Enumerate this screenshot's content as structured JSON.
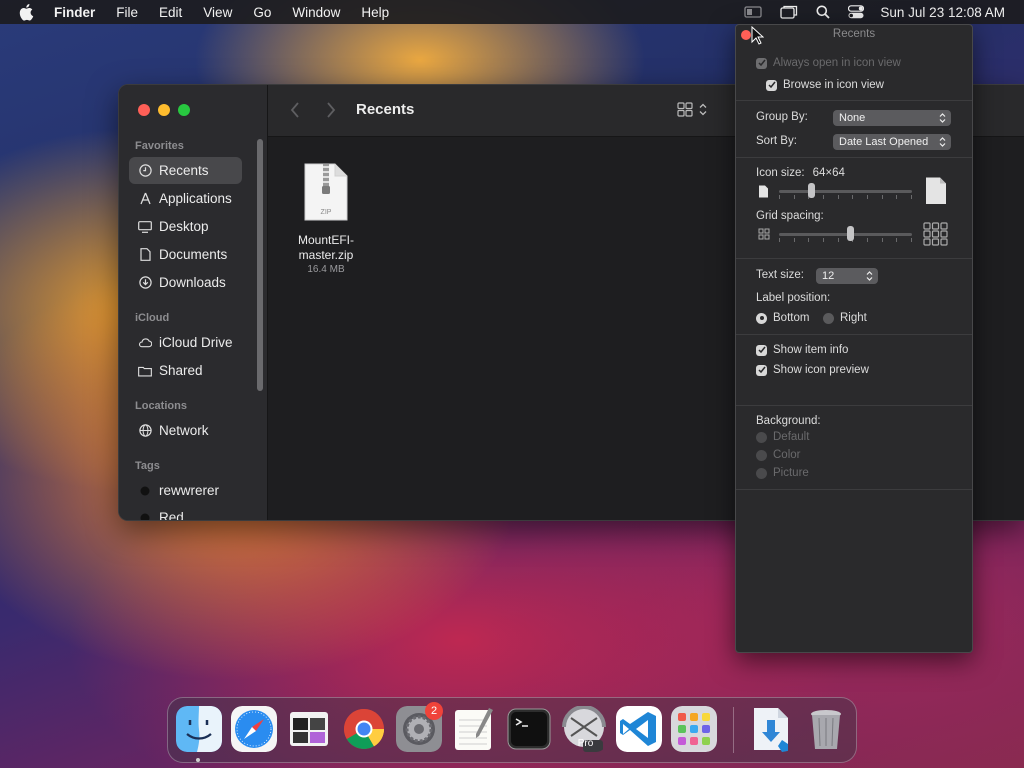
{
  "menubar": {
    "app_name": "Finder",
    "items": [
      "File",
      "Edit",
      "View",
      "Go",
      "Window",
      "Help"
    ],
    "clock": "Sun Jul 23  12:08 AM",
    "status_icons": [
      "screen-mirroring-icon",
      "window-icon",
      "spotlight-icon",
      "control-center-icon"
    ]
  },
  "finder": {
    "title": "Recents",
    "sidebar": {
      "sections": [
        {
          "header": "Favorites",
          "items": [
            {
              "label": "Recents",
              "icon": "clock-icon",
              "active": true
            },
            {
              "label": "Applications",
              "icon": "applications-icon"
            },
            {
              "label": "Desktop",
              "icon": "desktop-icon"
            },
            {
              "label": "Documents",
              "icon": "document-icon"
            },
            {
              "label": "Downloads",
              "icon": "download-icon"
            }
          ]
        },
        {
          "header": "iCloud",
          "items": [
            {
              "label": "iCloud Drive",
              "icon": "cloud-icon"
            },
            {
              "label": "Shared",
              "icon": "shared-folder-icon"
            }
          ]
        },
        {
          "header": "Locations",
          "items": [
            {
              "label": "Network",
              "icon": "globe-icon"
            }
          ]
        },
        {
          "header": "Tags",
          "items": [
            {
              "label": "rewwrerer",
              "icon": "tag-dot-icon"
            },
            {
              "label": "Red",
              "icon": "tag-dot-icon"
            }
          ]
        }
      ]
    },
    "files": [
      {
        "name_line1": "MountEFI-",
        "name_line2": "master.zip",
        "size": "16.4 MB",
        "type_label": "ZIP"
      }
    ]
  },
  "view_options": {
    "title": "Recents",
    "always_open": "Always open in icon view",
    "browse_icon": "Browse in icon view",
    "group_by_label": "Group By:",
    "group_by_value": "None",
    "sort_by_label": "Sort By:",
    "sort_by_value": "Date Last Opened",
    "icon_size_label": "Icon size:",
    "icon_size_value": "64×64",
    "icon_size_fraction": 0.23,
    "grid_spacing_label": "Grid spacing:",
    "grid_spacing_fraction": 0.54,
    "text_size_label": "Text size:",
    "text_size_value": "12",
    "label_position_label": "Label position:",
    "label_bottom": "Bottom",
    "label_right": "Right",
    "show_item_info": "Show item info",
    "show_icon_preview": "Show icon preview",
    "background_label": "Background:",
    "bg_default": "Default",
    "bg_color": "Color",
    "bg_picture": "Picture"
  },
  "dock": {
    "apps": [
      "Finder",
      "Safari",
      "Preview",
      "Chrome",
      "System Settings",
      "TextEdit",
      "Terminal",
      "Final Cut Pro",
      "Visual Studio Code",
      "Launchpad"
    ],
    "settings_badge": "2",
    "pro_label": "Pro",
    "right_items": [
      "Downloads",
      "Trash"
    ]
  }
}
